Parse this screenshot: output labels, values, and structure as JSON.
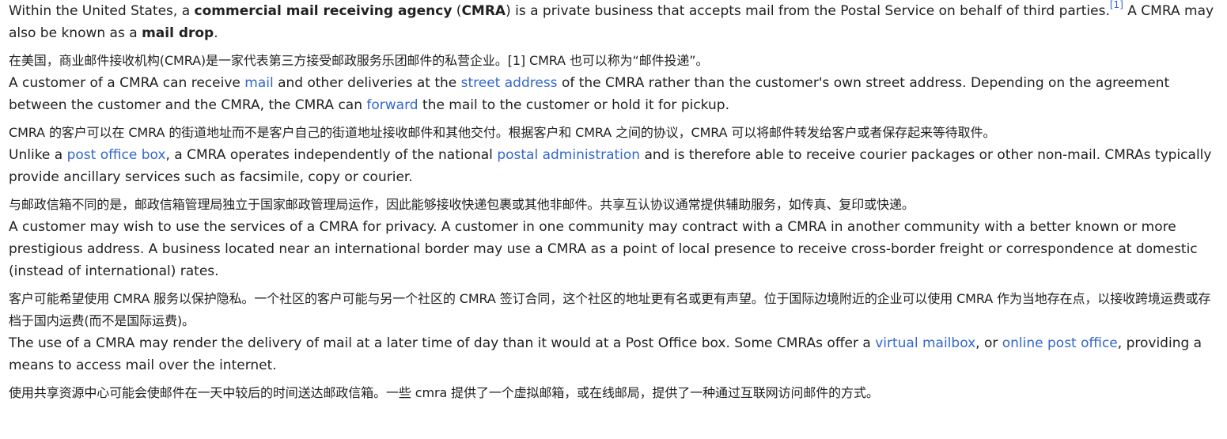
{
  "colors": {
    "text": "#202122",
    "link": "#3366cc",
    "background": "#ffffff"
  },
  "paragraphs": {
    "p1": {
      "t1": "Within the United States, a ",
      "b1": "commercial mail receiving agency",
      "t2": " (",
      "b2": "CMRA",
      "t3": ") is a private business that accepts mail from the Postal Service on behalf of third parties.",
      "ref": "[1]",
      "t4": " A CMRA may also be known as a ",
      "b3": "mail drop",
      "t5": "."
    },
    "p1_zh": "在美国，商业邮件接收机构(CMRA)是一家代表第三方接受邮政服务乐团邮件的私营企业。[1] CMRA 也可以称为“邮件投递”。",
    "p2": {
      "t1": "A customer of a CMRA can receive ",
      "l1": "mail",
      "t2": " and other deliveries at the ",
      "l2": "street address",
      "t3": " of the CMRA rather than the customer's own street address. Depending on the agreement between the customer and the CMRA, the CMRA can ",
      "l3": "forward",
      "t4": " the mail to the customer or hold it for pickup."
    },
    "p2_zh": "CMRA 的客户可以在 CMRA 的街道地址而不是客户自己的街道地址接收邮件和其他交付。根据客户和 CMRA 之间的协议，CMRA 可以将邮件转发给客户或者保存起来等待取件。",
    "p3": {
      "t1": "Unlike a ",
      "l1": "post office box",
      "t2": ", a CMRA operates independently of the national ",
      "l2": "postal administration",
      "t3": " and is therefore able to receive courier packages or other non-mail. CMRAs typically provide ancillary services such as facsimile, copy or courier."
    },
    "p3_zh": "与邮政信箱不同的是，邮政信箱管理局独立于国家邮政管理局运作，因此能够接收快递包裹或其他非邮件。共享互认协议通常提供辅助服务，如传真、复印或快递。",
    "p4": {
      "t1": "A customer may wish to use the services of a CMRA for privacy. A customer in one community may contract with a CMRA in another community with a better known or more prestigious address. A business located near an international border may use a CMRA as a point of local presence to receive cross-border freight or correspondence at domestic (instead of international) rates."
    },
    "p4_zh": "客户可能希望使用 CMRA 服务以保护隐私。一个社区的客户可能与另一个社区的 CMRA 签订合同，这个社区的地址更有名或更有声望。位于国际边境附近的企业可以使用 CMRA 作为当地存在点，以接收跨境运费或存档于国内运费(而不是国际运费)。",
    "p5": {
      "t1": "The use of a CMRA may render the delivery of mail at a later time of day than it would at a Post Office box. Some CMRAs offer a ",
      "l1": "virtual mailbox",
      "t2": ", or ",
      "l2": "online post office",
      "t3": ", providing a means to access mail over the internet."
    },
    "p5_zh": "使用共享资源中心可能会使邮件在一天中较后的时间送达邮政信箱。一些 cmra 提供了一个虚拟邮箱，或在线邮局，提供了一种通过互联网访问邮件的方式。"
  }
}
